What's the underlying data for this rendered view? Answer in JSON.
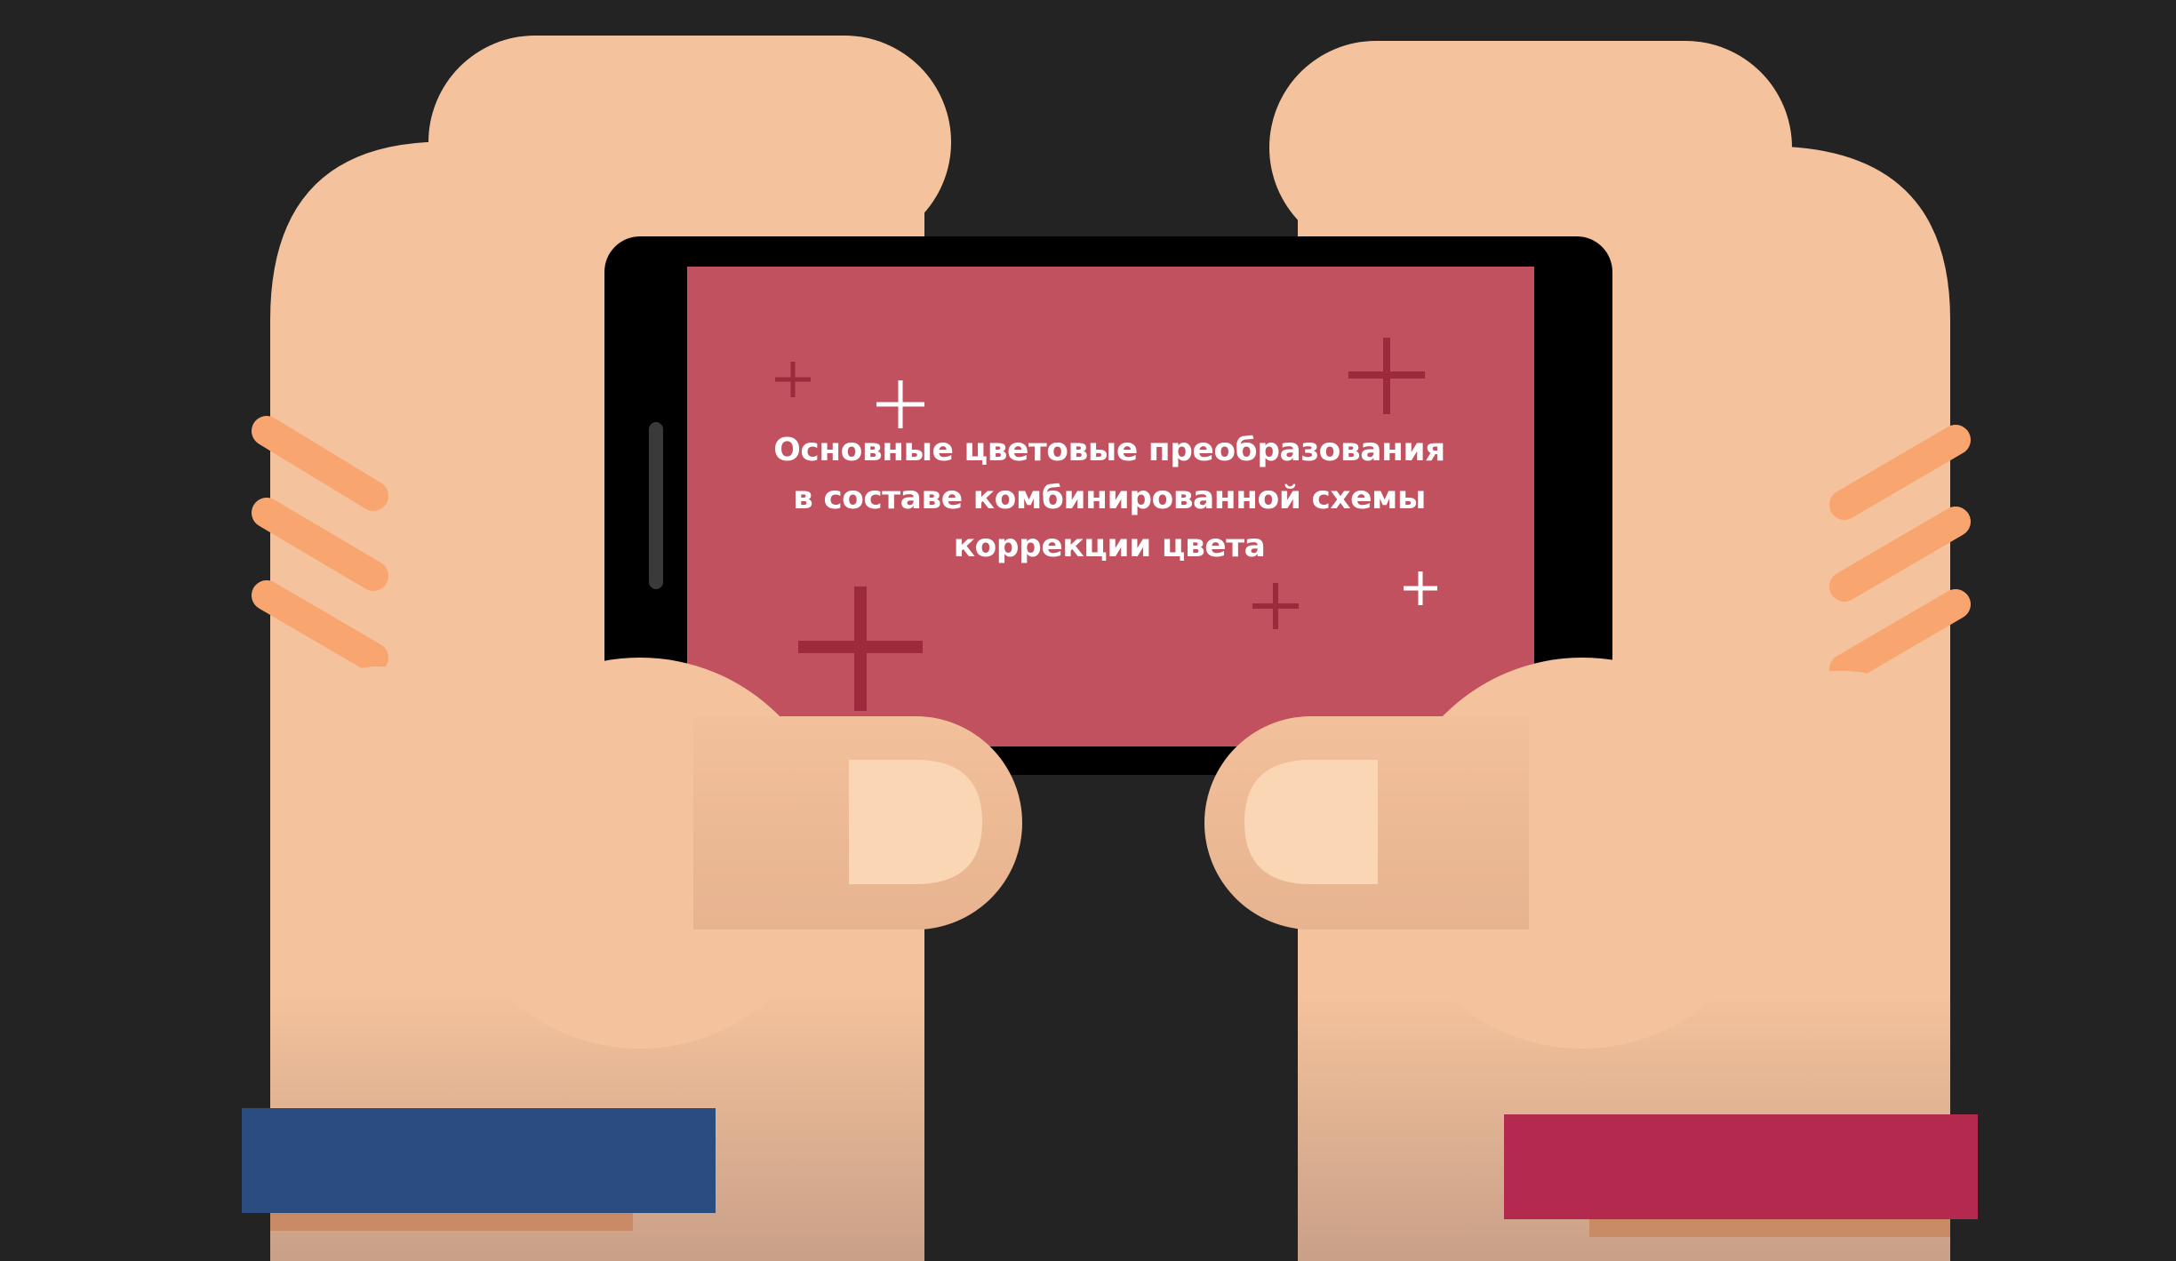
{
  "screen": {
    "title": "Основные цветовые преобразования\nв составе комбинированной схемы\nкоррекции цвета"
  },
  "colors": {
    "background": "#232323",
    "skin": "#f4c29c",
    "skin_shadow": "#d9a17e",
    "scratch": "#f9a56f",
    "thumbnail": "#fad6b5",
    "phone_body": "#000000",
    "phone_screen": "#c1515f",
    "sparkle_dark": "#9c2a3b",
    "sparkle_light": "#ffffff",
    "left_wristband": "#2b4c7e",
    "right_wristband": "#b32a4e"
  },
  "icons": {
    "sparkles": "plus-sparkle-icon",
    "phone_button": "volume-button-icon"
  }
}
